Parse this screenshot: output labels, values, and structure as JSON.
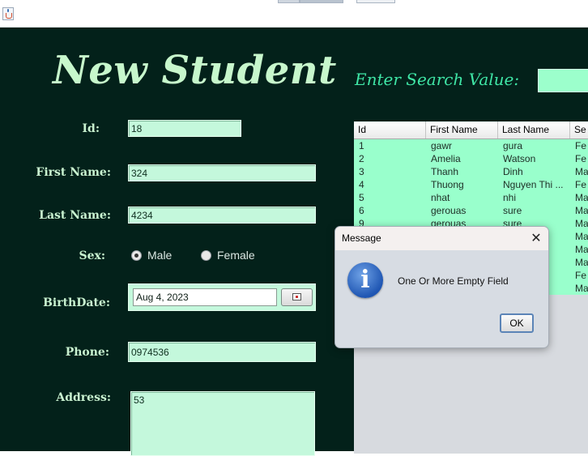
{
  "window": {
    "icon": "java-cup-icon"
  },
  "form": {
    "heading": "New Student",
    "search_label": "Enter Search Value:",
    "search_value": "",
    "id_label": "Id:",
    "id_value": "18",
    "first_name_label": "First Name:",
    "first_name_value": "324",
    "last_name_label": "Last Name:",
    "last_name_value": "4234",
    "sex_label": "Sex:",
    "sex_male": "Male",
    "sex_female": "Female",
    "sex_selected": "Male",
    "birthdate_label": "BirthDate:",
    "birthdate_value": "Aug 4, 2023",
    "phone_label": "Phone:",
    "phone_value": "0974536",
    "address_label": "Address:",
    "address_value": "53"
  },
  "table": {
    "columns": [
      "Id",
      "First Name",
      "Last Name",
      "Se"
    ],
    "rows": [
      [
        "1",
        "gawr",
        "gura",
        "Fe"
      ],
      [
        "2",
        "Amelia",
        "Watson",
        "Fe"
      ],
      [
        "3",
        "Thanh",
        "Dinh",
        "Ma"
      ],
      [
        "4",
        "Thuong",
        "Nguyen Thi ...",
        "Fe"
      ],
      [
        "5",
        "nhat",
        "nhi",
        "Ma"
      ],
      [
        "6",
        "gerouas",
        "sure",
        "Ma"
      ],
      [
        "9",
        "gerouas",
        "sure",
        "Ma"
      ],
      [
        "",
        "",
        "",
        "Ma"
      ],
      [
        "",
        "",
        "",
        "Ma"
      ],
      [
        "",
        "",
        "",
        "Ma"
      ],
      [
        "",
        "",
        "",
        "Fe"
      ],
      [
        "",
        "",
        "",
        "Ma"
      ]
    ]
  },
  "dialog": {
    "title": "Message",
    "close_glyph": "✕",
    "icon": "info-icon",
    "icon_glyph": "i",
    "message": "One Or More Empty Field",
    "ok_label": "OK"
  },
  "colors": {
    "background": "#03211a",
    "heading": "#c7f7cc",
    "search_label": "#3fe6a6",
    "field": "#c4f8dc",
    "table_rows": "#99ffcc"
  }
}
